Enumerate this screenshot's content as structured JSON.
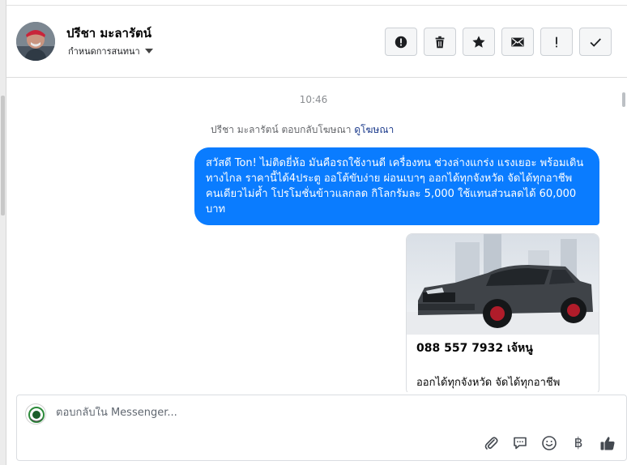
{
  "contact": {
    "name": "ปรีชา มะลารัตน์",
    "subtitle": "กำหนดการสนทนา"
  },
  "header_actions": [
    {
      "name": "alert-icon"
    },
    {
      "name": "trash-icon"
    },
    {
      "name": "star-icon"
    },
    {
      "name": "envelope-icon"
    },
    {
      "name": "exclamation-icon"
    },
    {
      "name": "checkmark-icon"
    }
  ],
  "chat": {
    "timestamp": "10:46",
    "reply_note": "ปรีชา มะลารัตน์ ตอบกลับโฆษณา",
    "reply_link": "ดูโฆษณา",
    "message": "สวัสดี Ton! ไม่ติดยี่ห้อ มันคือรถใช้งานดี เครื่องทน ช่วงล่างแกร่ง แรงเยอะ พร้อมเดินทางไกล ราคานี้ได้4ประตู ออโต้ขับง่าย ผ่อนเบาๆ ออกได้ทุกจังหวัด จัดได้ทุกอาชีพ คนเดียวไม่ค้ำ โปรโมชั่นข้าวแลกลด กิโลกรัมละ 5,000 ใช้แทนส่วนลดได้ 60,000 บาท",
    "card": {
      "title": "088 557 7932 เจ้หนู",
      "description": "ออกได้ทุกจังหวัด จัดได้ทุกอาชีพ"
    }
  },
  "composer": {
    "placeholder": "ตอบกลับใน Messenger...",
    "tools": [
      "paperclip-icon",
      "speech-bubble-icon",
      "smiley-icon",
      "baht-icon",
      "thumbs-up-icon"
    ],
    "baht_symbol": "฿"
  },
  "colors": {
    "bubble": "#0a7cff",
    "link": "#1c3b8c"
  }
}
